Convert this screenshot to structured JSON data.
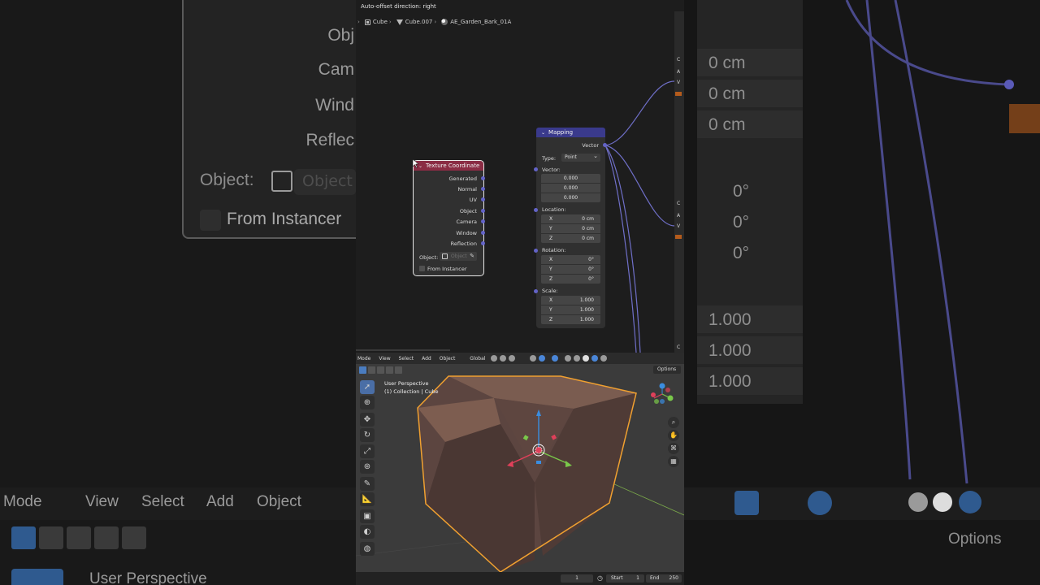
{
  "background": {
    "left": {
      "labels": [
        "Obj",
        "Cam",
        "Wind",
        "Reflec"
      ],
      "object_label": "Object:",
      "object_placeholder": "Object",
      "from_instancer": "From Instancer",
      "toolbar": [
        "Mode",
        "View",
        "Select",
        "Add",
        "Object"
      ],
      "viewport_label": "User Perspective"
    },
    "right": {
      "values": [
        "0 cm",
        "0 cm",
        "0 cm",
        "0°",
        "0°",
        "0°",
        "1.000",
        "1.000",
        "1.000"
      ],
      "options": "Options"
    }
  },
  "node_editor": {
    "status": "Auto-offset direction: right",
    "breadcrumb": [
      "Cube",
      "Cube.007",
      "AE_Garden_Bark_01A"
    ],
    "texture_coordinate": {
      "title": "Texture Coordinate",
      "outputs": [
        "Generated",
        "Normal",
        "UV",
        "Object",
        "Camera",
        "Window",
        "Reflection"
      ],
      "object_label": "Object:",
      "object_placeholder": "Object",
      "from_instancer": "From Instancer"
    },
    "mapping": {
      "title": "Mapping",
      "output": "Vector",
      "type_label": "Type:",
      "type_value": "Point",
      "vector_label": "Vector:",
      "vector_values": [
        "0.000",
        "0.000",
        "0.000"
      ],
      "location_label": "Location:",
      "location": [
        {
          "axis": "X",
          "value": "0 cm"
        },
        {
          "axis": "Y",
          "value": "0 cm"
        },
        {
          "axis": "Z",
          "value": "0 cm"
        }
      ],
      "rotation_label": "Rotation:",
      "rotation": [
        {
          "axis": "X",
          "value": "0°"
        },
        {
          "axis": "Y",
          "value": "0°"
        },
        {
          "axis": "Z",
          "value": "0°"
        }
      ],
      "scale_label": "Scale:",
      "scale": [
        {
          "axis": "X",
          "value": "1.000"
        },
        {
          "axis": "Y",
          "value": "1.000"
        },
        {
          "axis": "Z",
          "value": "1.000"
        }
      ]
    },
    "right_strip_labels": [
      "C",
      "A",
      "V",
      "C",
      "A",
      "V",
      "C"
    ]
  },
  "viewport": {
    "menus": [
      "Mode",
      "View",
      "Select",
      "Add",
      "Object"
    ],
    "orientation": "Global",
    "options": "Options",
    "perspective": "User Perspective",
    "collection": "(1) Collection | Cube",
    "colors": {
      "selection_outline": "#f0a030",
      "cube": "#6b5045",
      "axis_x": "#e0405a",
      "axis_y": "#7ac84a",
      "axis_z": "#3a8de0"
    }
  },
  "timeline": {
    "current_frame": "1",
    "start_label": "Start",
    "start": "1",
    "end_label": "End",
    "end": "250"
  }
}
